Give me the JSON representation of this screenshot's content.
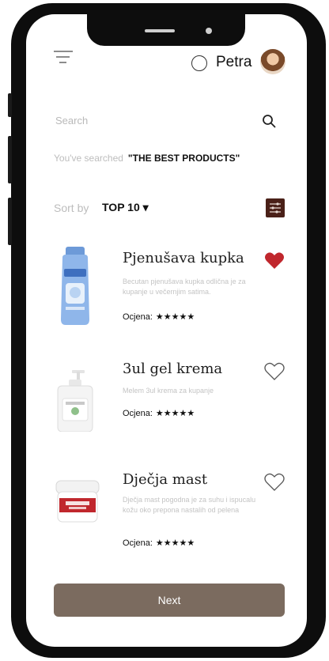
{
  "header": {
    "username": "Petra",
    "menu_icon": "hamburger-menu-icon",
    "avatar_icon": "user-avatar"
  },
  "search": {
    "placeholder": "Search",
    "value": "",
    "searched_label": "You've searched",
    "searched_query": "\"THE BEST PRODUCTS\""
  },
  "sort": {
    "label": "Sort by",
    "value": "TOP 10 ▾"
  },
  "products": [
    {
      "name": "Pjenušava kupka",
      "description": "Becutan pjenušava kupka odlična je za kupanje u večernjim satima.",
      "rating_label": "Ocjena:",
      "stars": "★★★★★",
      "favorite": true
    },
    {
      "name": "3ul gel krema",
      "description": "Melem 3ul krema za kupanje",
      "rating_label": "Ocjena:",
      "stars": "★★★★★",
      "favorite": false
    },
    {
      "name": "Dječja mast",
      "description": "Dječja mast pogodna je za suhu i ispucalu kožu oko prepona nastalih od pelena",
      "rating_label": "Ocjena:",
      "stars": "★★★★★",
      "favorite": false
    }
  ],
  "footer": {
    "next_label": "Next"
  },
  "colors": {
    "heart_filled": "#c0272d",
    "button_bg": "#7b6b5f",
    "filter_bg": "#4a2018"
  }
}
